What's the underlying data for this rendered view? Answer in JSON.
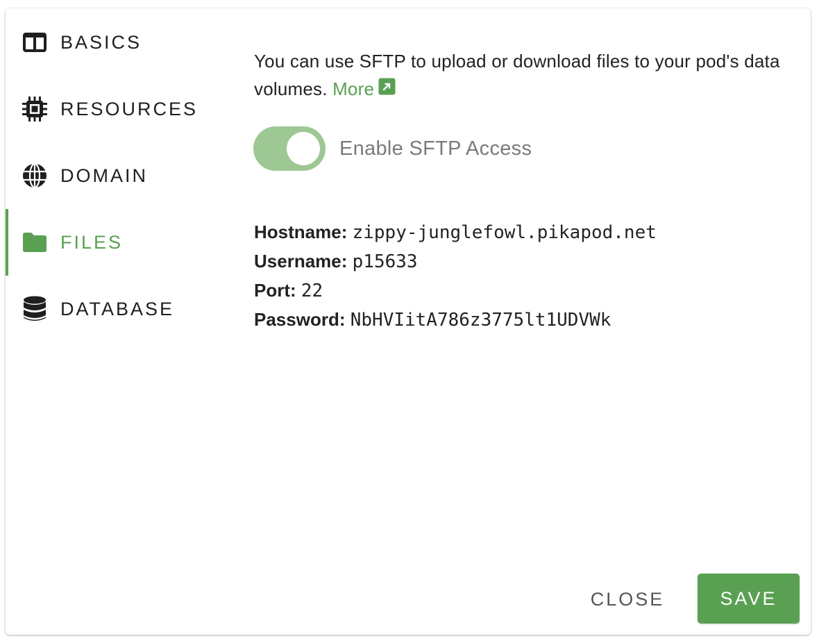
{
  "sidebar": {
    "items": [
      {
        "label": "BASICS",
        "icon": "columns-icon",
        "active": false
      },
      {
        "label": "RESOURCES",
        "icon": "chip-icon",
        "active": false
      },
      {
        "label": "DOMAIN",
        "icon": "globe-icon",
        "active": false
      },
      {
        "label": "FILES",
        "icon": "folder-icon",
        "active": true
      },
      {
        "label": "DATABASE",
        "icon": "database-icon",
        "active": false
      }
    ]
  },
  "files": {
    "intro_text": "You can use SFTP to upload or download files to your pod's data volumes.",
    "more_link": "More",
    "toggle": {
      "label": "Enable SFTP Access",
      "enabled": true
    },
    "credentials": [
      {
        "key": "Hostname:",
        "value": "zippy-junglefowl.pikapod.net"
      },
      {
        "key": "Username:",
        "value": "p15633"
      },
      {
        "key": "Port:",
        "value": "22"
      },
      {
        "key": "Password:",
        "value": "NbHVIitA786z3775lt1UDVWk"
      }
    ]
  },
  "footer": {
    "close_label": "CLOSE",
    "save_label": "SAVE"
  },
  "colors": {
    "accent": "#5aa052",
    "toggle_track": "#9dc894",
    "text": "#222222",
    "muted": "#7a7a7a"
  }
}
